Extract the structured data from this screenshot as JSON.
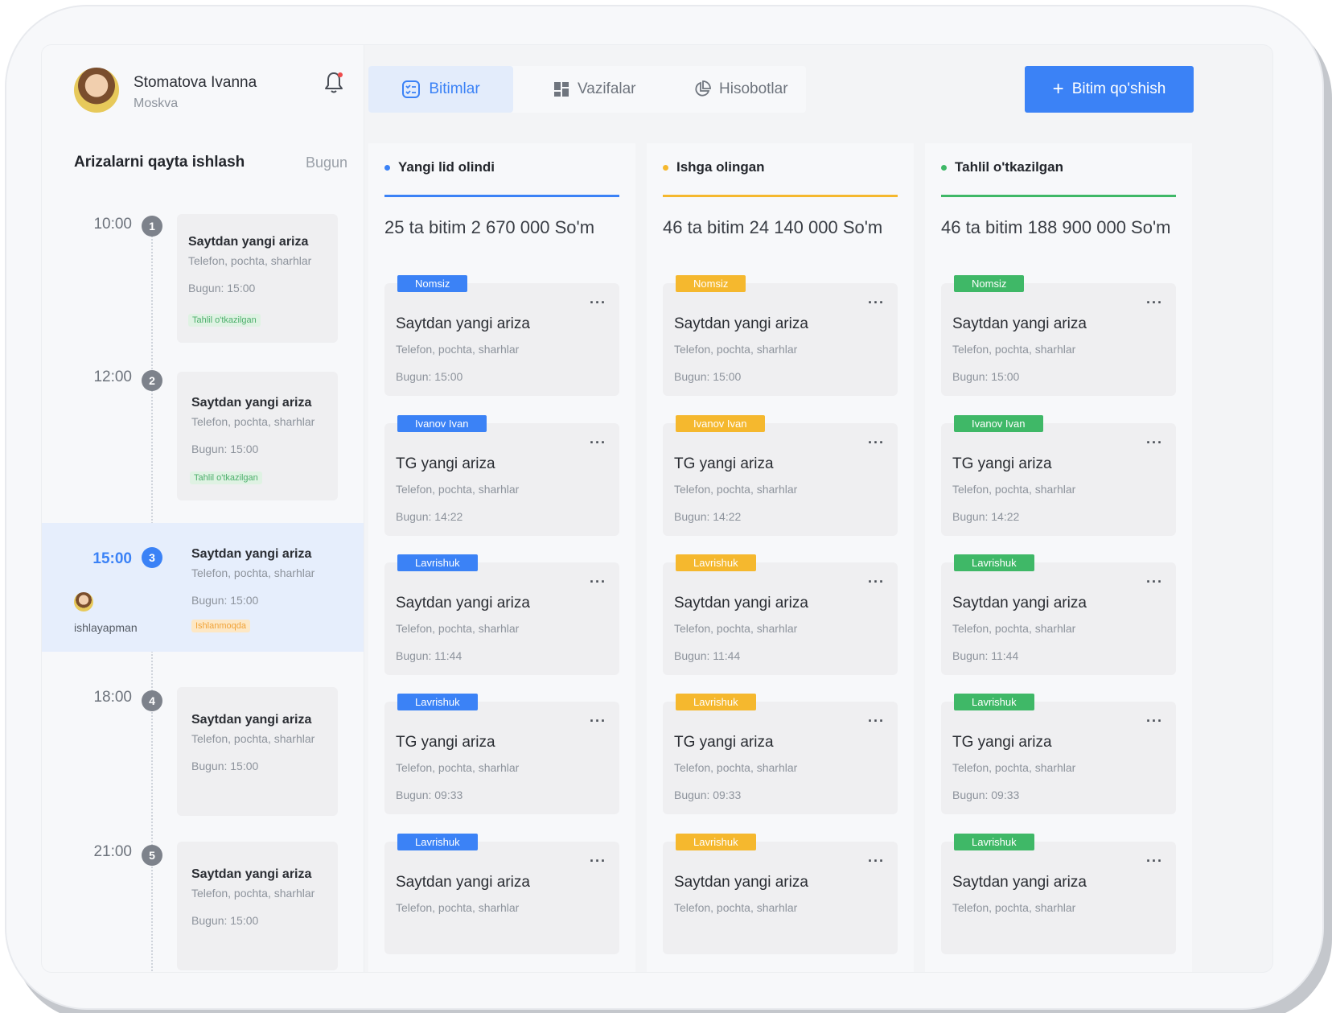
{
  "user": {
    "name": "Stomatova Ivanna",
    "city": "Moskva"
  },
  "sidebar": {
    "title": "Arizalarni qayta ishlash",
    "today": "Bugun",
    "slots": [
      {
        "time": "10:00",
        "num": "1",
        "title": "Saytdan yangi ariza",
        "sub": "Telefon, pochta, sharhlar",
        "when": "Bugun: 15:00",
        "tag": "Tahlil o'tkazilgan"
      },
      {
        "time": "12:00",
        "num": "2",
        "title": "Saytdan yangi ariza",
        "sub": "Telefon, pochta, sharhlar",
        "when": "Bugun: 15:00",
        "tag": "Tahlil o'tkazilgan"
      },
      {
        "time": "15:00",
        "num": "3",
        "title": "Saytdan yangi ariza",
        "sub": "Telefon, pochta, sharhlar",
        "when": "Bugun: 15:00",
        "tag": "Ishlanmoqda",
        "assignee": "ishlayapman"
      },
      {
        "time": "18:00",
        "num": "4",
        "title": "Saytdan yangi ariza",
        "sub": "Telefon, pochta, sharhlar",
        "when": "Bugun: 15:00"
      },
      {
        "time": "21:00",
        "num": "5",
        "title": "Saytdan yangi ariza",
        "sub": "Telefon, pochta, sharhlar",
        "when": "Bugun: 15:00"
      }
    ]
  },
  "tabs": [
    "Bitimlar",
    "Vazifalar",
    "Hisobotlar"
  ],
  "add_button": "Bitim qo'shish",
  "columns": [
    {
      "title": "Yangi lid olindi",
      "color": "#3b82f6",
      "summary": "25 ta bitim 2 670 000 So'm",
      "cards": [
        {
          "badge": "Nomsiz",
          "title": "Saytdan yangi ariza",
          "sub": "Telefon, pochta, sharhlar",
          "time": "Bugun: 15:00"
        },
        {
          "badge": "Ivanov Ivan",
          "title": "TG yangi ariza",
          "sub": "Telefon, pochta, sharhlar",
          "time": "Bugun: 14:22"
        },
        {
          "badge": "Lavrishuk",
          "title": "Saytdan yangi ariza",
          "sub": "Telefon, pochta, sharhlar",
          "time": "Bugun: 11:44"
        },
        {
          "badge": "Lavrishuk",
          "title": "TG yangi ariza",
          "sub": "Telefon, pochta, sharhlar",
          "time": "Bugun: 09:33"
        },
        {
          "badge": "Lavrishuk",
          "title": "Saytdan yangi ariza",
          "sub": "Telefon, pochta, sharhlar",
          "time": ""
        }
      ]
    },
    {
      "title": "Ishga olingan",
      "color": "#f5b82e",
      "summary": "46 ta bitim 24 140 000 So'm",
      "cards": [
        {
          "badge": "Nomsiz",
          "title": "Saytdan yangi ariza",
          "sub": "Telefon, pochta, sharhlar",
          "time": "Bugun: 15:00"
        },
        {
          "badge": "Ivanov Ivan",
          "title": "TG yangi ariza",
          "sub": "Telefon, pochta, sharhlar",
          "time": "Bugun: 14:22"
        },
        {
          "badge": "Lavrishuk",
          "title": "Saytdan yangi ariza",
          "sub": "Telefon, pochta, sharhlar",
          "time": "Bugun: 11:44"
        },
        {
          "badge": "Lavrishuk",
          "title": "TG yangi ariza",
          "sub": "Telefon, pochta, sharhlar",
          "time": "Bugun: 09:33"
        },
        {
          "badge": "Lavrishuk",
          "title": "Saytdan yangi ariza",
          "sub": "Telefon, pochta, sharhlar",
          "time": ""
        }
      ]
    },
    {
      "title": "Tahlil o'tkazilgan",
      "color": "#3fb867",
      "summary": "46 ta bitim 188 900 000 So'm",
      "cards": [
        {
          "badge": "Nomsiz",
          "title": "Saytdan yangi ariza",
          "sub": "Telefon, pochta, sharhlar",
          "time": "Bugun: 15:00"
        },
        {
          "badge": "Ivanov Ivan",
          "title": "TG yangi ariza",
          "sub": "Telefon, pochta, sharhlar",
          "time": "Bugun: 14:22"
        },
        {
          "badge": "Lavrishuk",
          "title": "Saytdan yangi ariza",
          "sub": "Telefon, pochta, sharhlar",
          "time": "Bugun: 11:44"
        },
        {
          "badge": "Lavrishuk",
          "title": "TG yangi ariza",
          "sub": "Telefon, pochta, sharhlar",
          "time": "Bugun: 09:33"
        },
        {
          "badge": "Lavrishuk",
          "title": "Saytdan yangi ariza",
          "sub": "Telefon, pochta, sharhlar",
          "time": ""
        }
      ]
    }
  ]
}
